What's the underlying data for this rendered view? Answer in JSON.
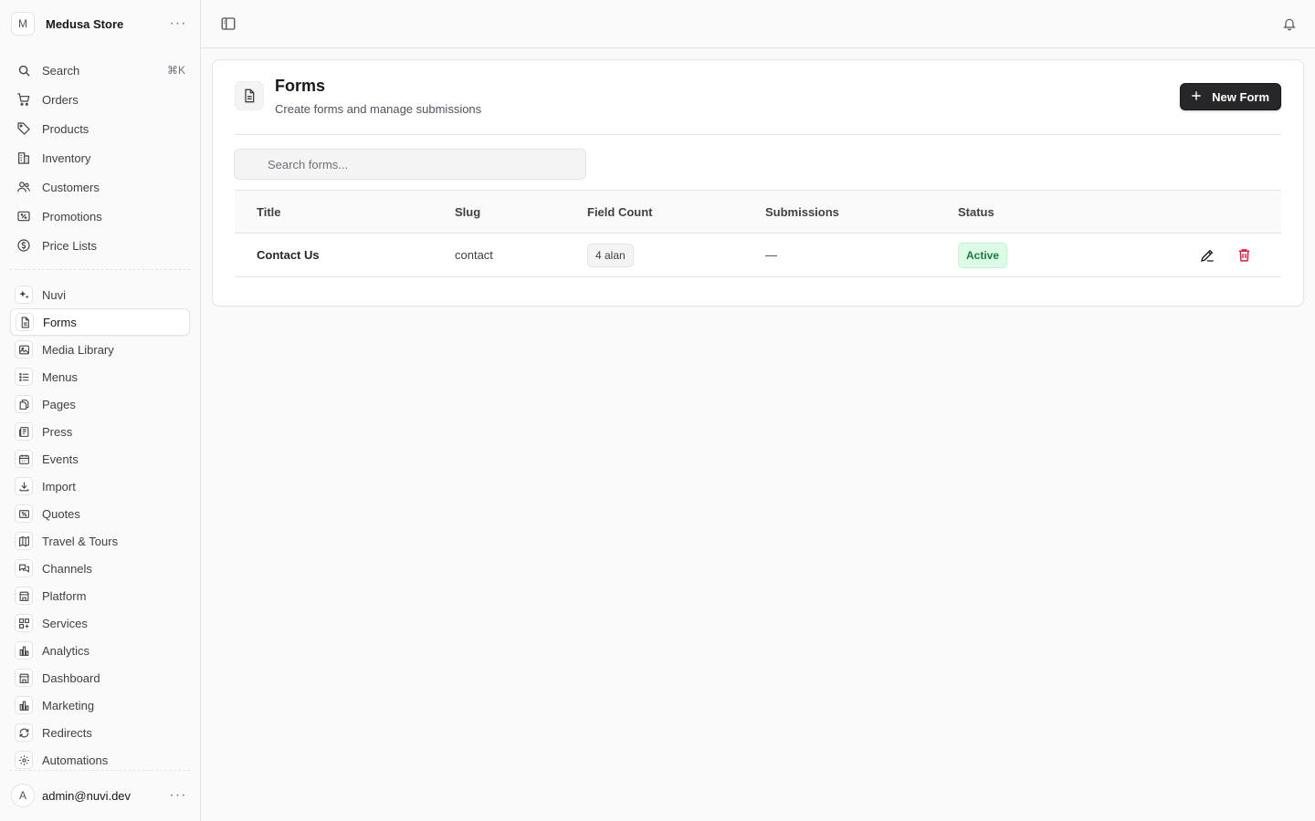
{
  "store": {
    "initial": "M",
    "name": "Medusa Store"
  },
  "search": {
    "label": "Search",
    "shortcut": "⌘K"
  },
  "nav_primary": [
    {
      "label": "Orders",
      "icon": "cart-icon"
    },
    {
      "label": "Products",
      "icon": "tag-icon"
    },
    {
      "label": "Inventory",
      "icon": "building-icon"
    },
    {
      "label": "Customers",
      "icon": "users-icon"
    },
    {
      "label": "Promotions",
      "icon": "receipt-percent-icon"
    },
    {
      "label": "Price Lists",
      "icon": "currency-dollar-icon"
    }
  ],
  "nav_extensions": [
    {
      "label": "Nuvi",
      "icon": "sparkles-icon"
    },
    {
      "label": "Forms",
      "icon": "document-icon"
    },
    {
      "label": "Media Library",
      "icon": "photo-icon"
    },
    {
      "label": "Menus",
      "icon": "list-bullet-icon"
    },
    {
      "label": "Pages",
      "icon": "documents-icon"
    },
    {
      "label": "Press",
      "icon": "newspaper-icon"
    },
    {
      "label": "Events",
      "icon": "calendar-icon"
    },
    {
      "label": "Import",
      "icon": "download-icon"
    },
    {
      "label": "Quotes",
      "icon": "receipt-percent-icon"
    },
    {
      "label": "Travel & Tours",
      "icon": "map-icon"
    },
    {
      "label": "Channels",
      "icon": "chat-bubbles-icon"
    },
    {
      "label": "Platform",
      "icon": "building-storefront-icon"
    },
    {
      "label": "Services",
      "icon": "squares-plus-icon"
    },
    {
      "label": "Analytics",
      "icon": "chart-bar-icon"
    },
    {
      "label": "Dashboard",
      "icon": "building-storefront-icon"
    },
    {
      "label": "Marketing",
      "icon": "chart-bar-icon"
    },
    {
      "label": "Redirects",
      "icon": "arrow-path-icon"
    },
    {
      "label": "Automations",
      "icon": "cog-icon"
    }
  ],
  "user": {
    "initial": "A",
    "email": "admin@nuvi.dev"
  },
  "page": {
    "title": "Forms",
    "subtitle": "Create forms and manage submissions",
    "new_button": "New Form",
    "search_placeholder": "Search forms..."
  },
  "table": {
    "columns": [
      "Title",
      "Slug",
      "Field Count",
      "Submissions",
      "Status"
    ],
    "rows": [
      {
        "title": "Contact Us",
        "slug": "contact",
        "field_count": "4 alan",
        "submissions": "—",
        "status": "Active"
      }
    ]
  },
  "colors": {
    "accent": "#27272a",
    "status_active_bg": "#dcfce7",
    "status_active_text": "#15803d",
    "danger": "#e11d48"
  }
}
